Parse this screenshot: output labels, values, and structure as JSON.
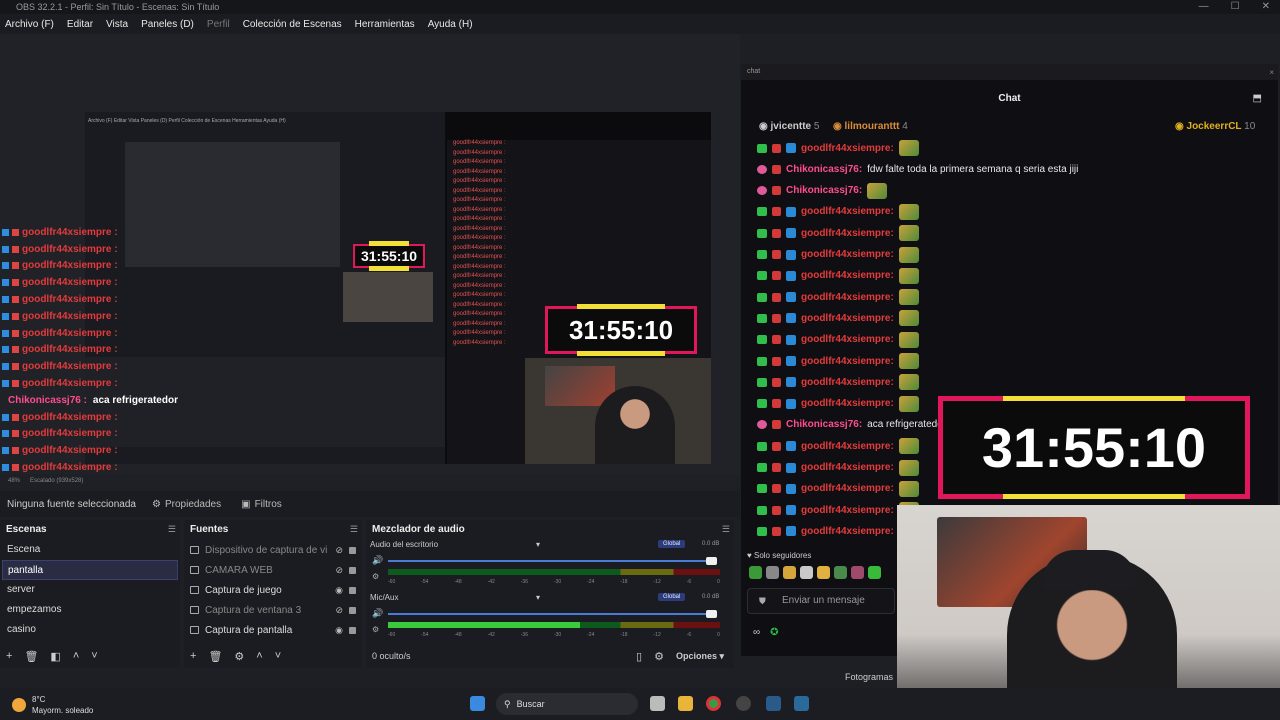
{
  "window": {
    "title": "OBS 32.2.1 - Perfil: Sin Título - Escenas: Sin Título",
    "min": "—",
    "max": "☐",
    "close": "✕"
  },
  "menu": [
    {
      "label": "Archivo (F)",
      "disabled": false
    },
    {
      "label": "Editar",
      "disabled": false
    },
    {
      "label": "Vista",
      "disabled": false
    },
    {
      "label": "Paneles (D)",
      "disabled": false
    },
    {
      "label": "Perfil",
      "disabled": true
    },
    {
      "label": "Colección de Escenas",
      "disabled": false
    },
    {
      "label": "Herramientas",
      "disabled": false
    },
    {
      "label": "Ayuda (H)",
      "disabled": false
    }
  ],
  "preview": {
    "timer": "31:55:10",
    "mini_timer": "31:55:10",
    "zoom": "48%",
    "scale": "Escalado (939x528)",
    "overflow_user": "goodlfr44xsiempre :",
    "overflow_user2": "Chikonicassj76 :",
    "overflow_msg2": "aca refrigeratedor"
  },
  "source_bar": {
    "no_source": "Ninguna fuente seleccionada",
    "properties": "Propiedades",
    "filters": "Filtros"
  },
  "scenes": {
    "title": "Escenas",
    "items": [
      "Escena",
      "pantalla",
      "server",
      "empezamos",
      "casino"
    ],
    "selected_index": 1
  },
  "sources": {
    "title": "Fuentes",
    "items": [
      {
        "label": "Dispositivo de captura de vi",
        "dim": true,
        "visible": false
      },
      {
        "label": "CAMARA WEB",
        "dim": true,
        "visible": false
      },
      {
        "label": "Captura de juego",
        "dim": false,
        "visible": true
      },
      {
        "label": "Captura de ventana 3",
        "dim": true,
        "visible": false
      },
      {
        "label": "Captura de pantalla",
        "dim": false,
        "visible": true
      }
    ]
  },
  "mixer": {
    "title": "Mezclador de audio",
    "tracks": [
      {
        "name": "Audio del escritorio",
        "badge": "Global",
        "db": "0.0 dB"
      },
      {
        "name": "Mic/Aux",
        "badge": "Global",
        "db": "0.0 dB"
      }
    ],
    "ticks": [
      "-60",
      "-54",
      "-48",
      "-42",
      "-36",
      "-30",
      "-24",
      "-18",
      "-12",
      "-6",
      "0"
    ],
    "hidden": "0 oculto/s",
    "options": "Opciones"
  },
  "chat": {
    "window_label": "chat",
    "header": "Chat",
    "leaders": [
      {
        "name": "jvicentte",
        "count": "5"
      },
      {
        "name": "lilmouranttt",
        "count": "4"
      },
      {
        "name": "JockeerrCL",
        "count": "10"
      }
    ],
    "messages": [
      {
        "user": "goodlfr44xsiempre:",
        "text": "",
        "pink": false,
        "emote": true
      },
      {
        "user": "Chikonicassj76:",
        "text": "fdw falte toda la primera semana q seria esta jiji",
        "pink": true,
        "emote": false
      },
      {
        "user": "Chikonicassj76:",
        "text": "",
        "pink": true,
        "emote": true
      },
      {
        "user": "goodlfr44xsiempre:",
        "text": "",
        "pink": false,
        "emote": true
      },
      {
        "user": "goodlfr44xsiempre:",
        "text": "",
        "pink": false,
        "emote": true
      },
      {
        "user": "goodlfr44xsiempre:",
        "text": "",
        "pink": false,
        "emote": true
      },
      {
        "user": "goodlfr44xsiempre:",
        "text": "",
        "pink": false,
        "emote": true
      },
      {
        "user": "goodlfr44xsiempre:",
        "text": "",
        "pink": false,
        "emote": true
      },
      {
        "user": "goodlfr44xsiempre:",
        "text": "",
        "pink": false,
        "emote": true
      },
      {
        "user": "goodlfr44xsiempre:",
        "text": "",
        "pink": false,
        "emote": true
      },
      {
        "user": "goodlfr44xsiempre:",
        "text": "",
        "pink": false,
        "emote": true
      },
      {
        "user": "goodlfr44xsiempre:",
        "text": "",
        "pink": false,
        "emote": true
      },
      {
        "user": "goodlfr44xsiempre:",
        "text": "",
        "pink": false,
        "emote": true
      },
      {
        "user": "Chikonicassj76:",
        "text": "aca refrigeratedor",
        "pink": true,
        "emote": false
      },
      {
        "user": "goodlfr44xsiempre:",
        "text": "",
        "pink": false,
        "emote": true
      },
      {
        "user": "goodlfr44xsiempre:",
        "text": "",
        "pink": false,
        "emote": true
      },
      {
        "user": "goodlfr44xsiempre:",
        "text": "",
        "pink": false,
        "emote": true
      },
      {
        "user": "goodlfr44xsiempre:",
        "text": "",
        "pink": false,
        "emote": true
      },
      {
        "user": "goodlfr44xsiempre:",
        "text": "",
        "pink": false,
        "emote": true
      }
    ],
    "followers_only": "Solo seguidores",
    "input_placeholder": "Enviar un mensaje",
    "footer_icon": "∞"
  },
  "status": {
    "frames": "Fotogramas"
  },
  "taskbar": {
    "temp": "8°C",
    "weather": "Mayorm. soleado",
    "search": "Buscar"
  },
  "colors": {
    "accent": "#4a7cd6",
    "timer_border": "#e0175a",
    "timer_bar": "#f2e036",
    "chat_user": "#e43b3b",
    "chat_user_pink": "#ff4d8d"
  }
}
